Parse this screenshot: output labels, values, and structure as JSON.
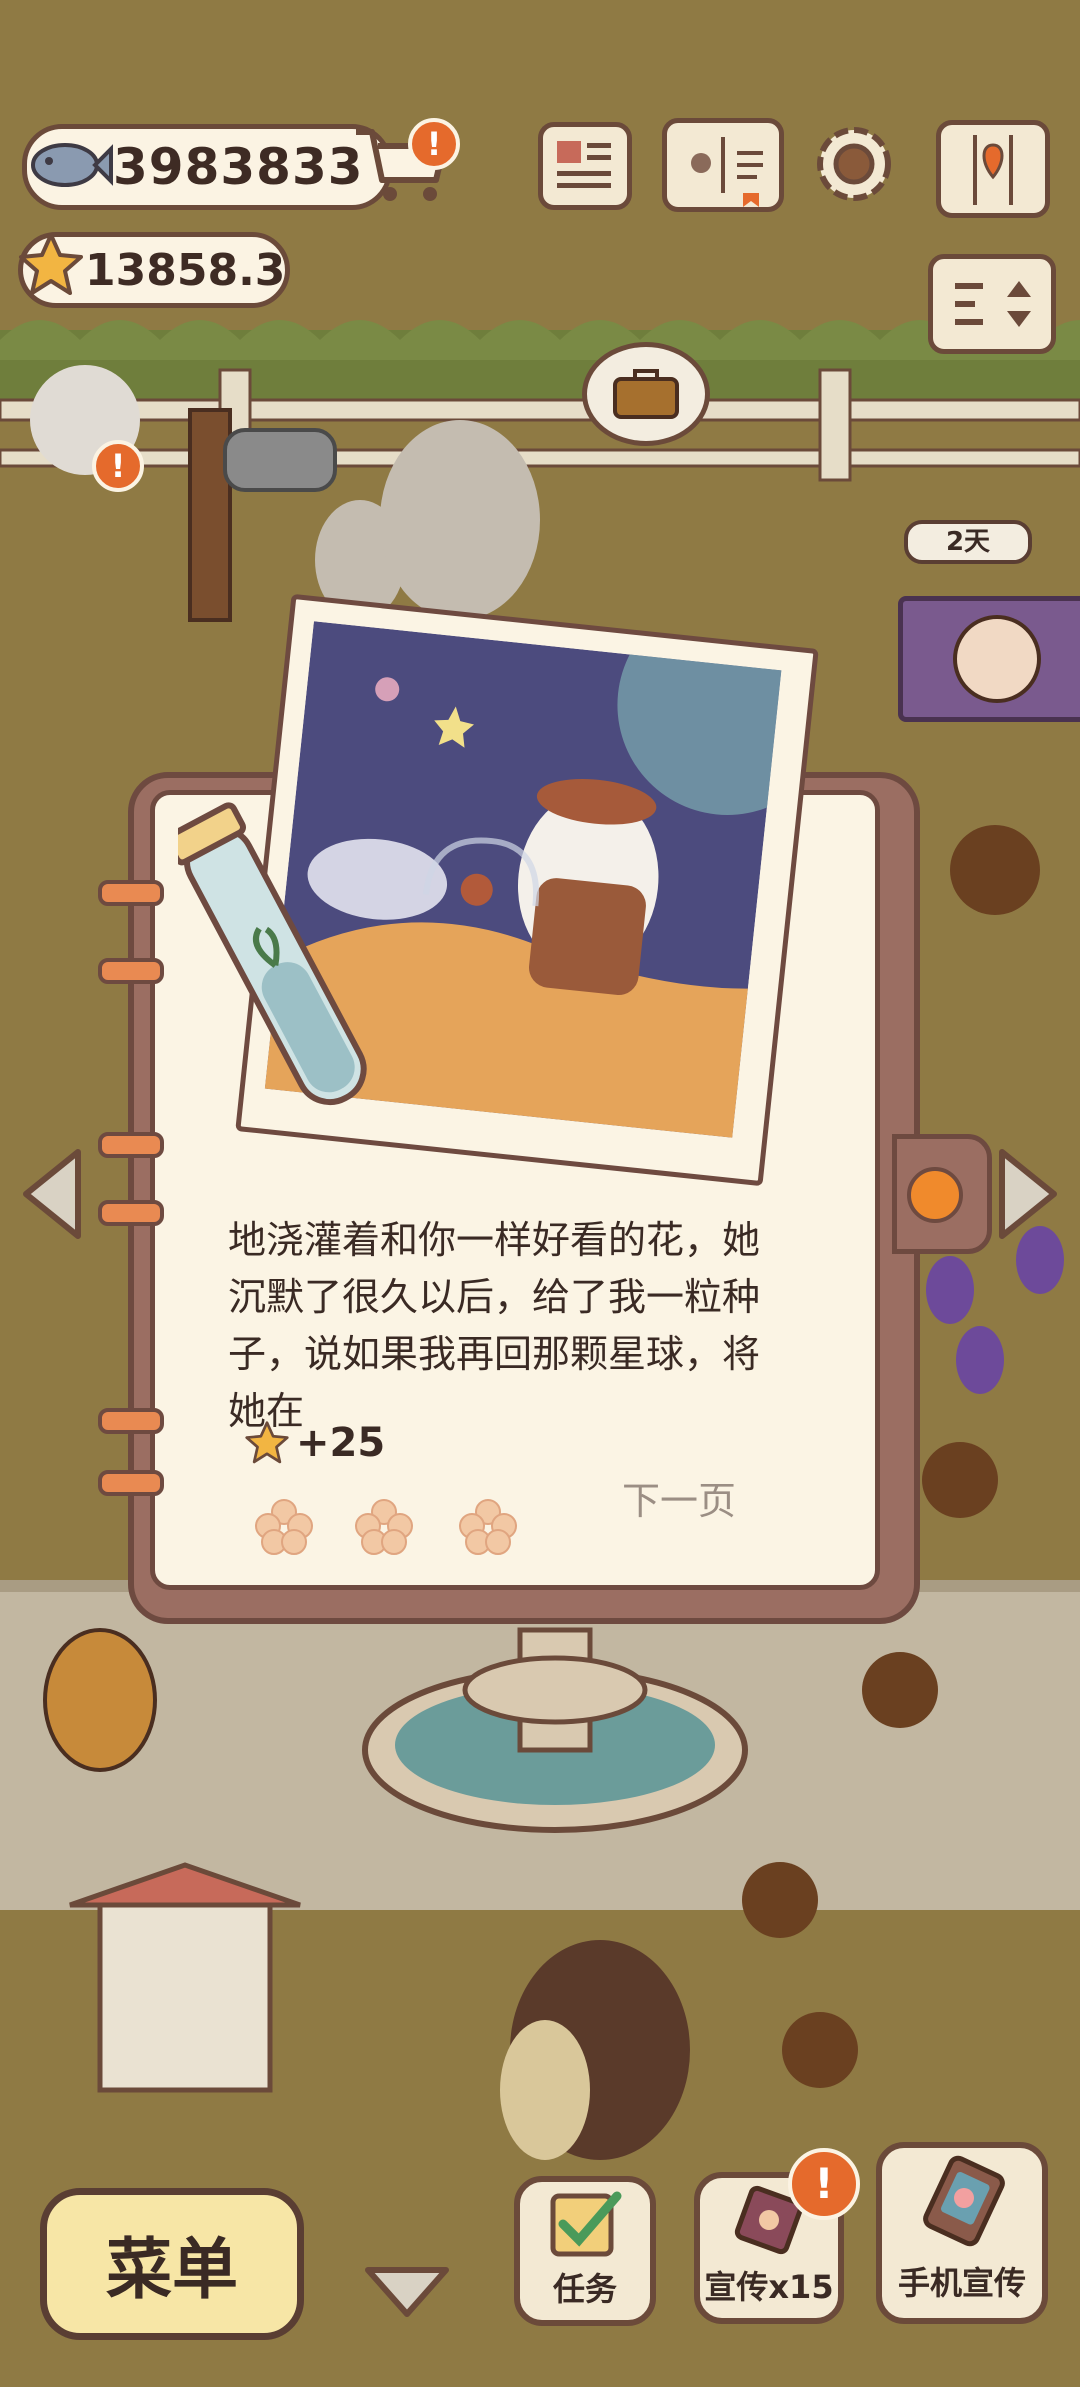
{
  "hud": {
    "fish_count": "3983833",
    "star_count": "13858.3",
    "icons": [
      "fish-icon",
      "cart-icon",
      "newspaper-icon",
      "book-icon",
      "gear-icon",
      "map-icon",
      "star-icon",
      "sort-icon"
    ]
  },
  "scene": {
    "visitor_timer": "2天"
  },
  "story": {
    "text": "地浇灌着和你一样好看的花，她沉默了很久以后，给了我一粒种子，说如果我再回那颗星球，将她在",
    "reward_label": "+25",
    "next_label": "下一页"
  },
  "bottom_bar": {
    "menu_label": "菜单",
    "task_label": "任务",
    "promote_label": "宣传x15",
    "phone_promote_label": "手机宣传"
  },
  "colors": {
    "ground": "#8f7a44",
    "paper": "#fbf4e4",
    "notebook": "#9b6e62",
    "alert": "#e56a2c"
  }
}
